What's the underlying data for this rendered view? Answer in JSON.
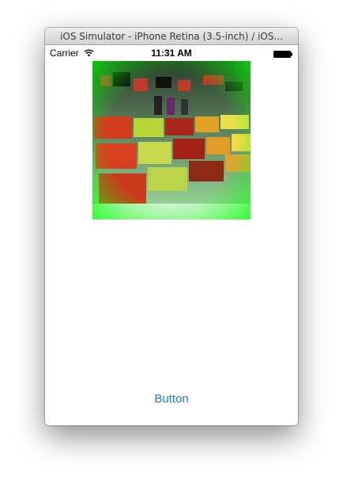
{
  "window": {
    "title": "iOS Simulator - iPhone Retina (3.5-inch) / iOS..."
  },
  "statusbar": {
    "carrier": "Carrier",
    "wifi_icon": "wifi-icon",
    "time": "11:31 AM",
    "battery_icon": "battery-icon"
  },
  "main": {
    "image": {
      "description_icon": "fruit-stand-photo",
      "tint_color": "#00ff00"
    },
    "button_label": "Button",
    "button_color": "#1a7fd4"
  }
}
